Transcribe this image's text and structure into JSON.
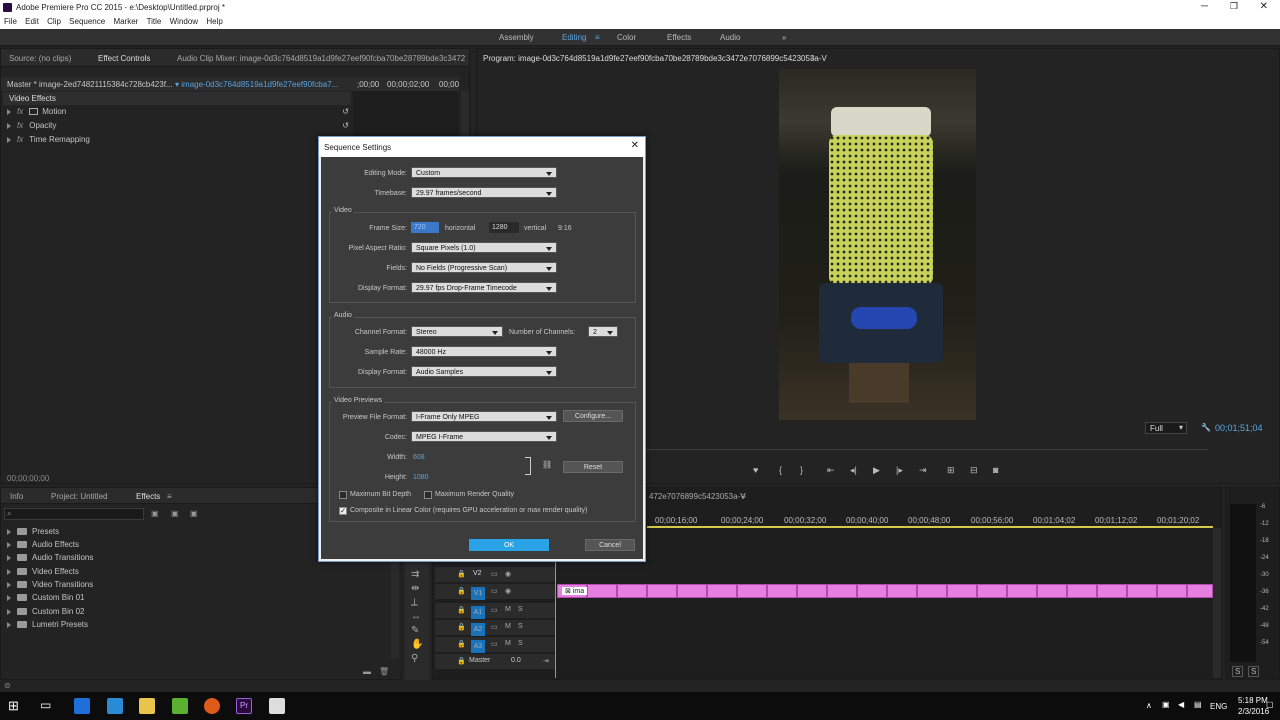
{
  "app": {
    "title": "Adobe Premiere Pro CC 2015 - e:\\Desktop\\Untitled.prproj *"
  },
  "menu": [
    "File",
    "Edit",
    "Clip",
    "Sequence",
    "Marker",
    "Title",
    "Window",
    "Help"
  ],
  "workspaces": [
    "Assembly",
    "Editing",
    "Color",
    "Effects",
    "Audio"
  ],
  "tabs_top": {
    "source": "Source: (no clips)",
    "effect_controls": "Effect Controls",
    "audio_mixer": "Audio Clip Mixer: image-0d3c764d8519a1d9fe27eef90fcba70be28789bde3c3472"
  },
  "effect_controls": {
    "master": "Master * image-2ed74821115384c728cb423f...",
    "clip": "image-0d3c764d8519a1d9fe27eef90fcba7...",
    "section": "Video Effects",
    "effects": [
      "Motion",
      "Opacity",
      "Time Remapping"
    ],
    "tc_start": ";00;00",
    "tc_mid": "00;00;02;00",
    "tc_end": "00;00",
    "clip_label": "image-2ed74821115384c728cb4",
    "timecode": "00;00;00;00"
  },
  "program": {
    "tab": "Program: image-0d3c764d8519a1d9fe27eef90fcba70be28789bde3c3472e7076899c5423053a-V",
    "zoom": "Full",
    "timecode": "00;01;51;04"
  },
  "bottom_tabs": {
    "info": "Info",
    "project": "Project: Untitled",
    "effects": "Effects"
  },
  "effects_panel": {
    "folders": [
      "Presets",
      "Audio Effects",
      "Audio Transitions",
      "Video Effects",
      "Video Transitions",
      "Custom Bin 01",
      "Custom Bin 02",
      "Lumetri Presets"
    ]
  },
  "timeline": {
    "tab": "472e7076899c5423053a-V",
    "ruler": [
      "00;00;16;00",
      "00;00;24;00",
      "00;00;32;00",
      "00;00;40;00",
      "00;00;48;00",
      "00;00;56;00",
      "00;01;04;02",
      "00;01;12;02",
      "00;01;20;02"
    ],
    "tracks": [
      "V2",
      "V1",
      "A1",
      "A2",
      "A3"
    ],
    "master": "Master",
    "master_val": "0.0",
    "clip_text": "ima"
  },
  "meter": {
    "labels": [
      "-6",
      "-12",
      "-18",
      "-24",
      "-30",
      "-36",
      "-42",
      "-48",
      "-54"
    ],
    "s": "S"
  },
  "dialog": {
    "title": "Sequence Settings",
    "editing_mode_label": "Editing Mode:",
    "editing_mode": "Custom",
    "timebase_label": "Timebase:",
    "timebase": "29.97  frames/second",
    "video_group": "Video",
    "frame_size_label": "Frame Size:",
    "frame_w": "720",
    "horizontal": "horizontal",
    "frame_h": "1280",
    "vertical": "vertical",
    "ratio": "9:16",
    "par_label": "Pixel Aspect Ratio:",
    "par": "Square Pixels (1.0)",
    "fields_label": "Fields:",
    "fields": "No Fields (Progressive Scan)",
    "vdisplay_label": "Display Format:",
    "vdisplay": "29.97 fps Drop-Frame Timecode",
    "audio_group": "Audio",
    "channel_label": "Channel Format:",
    "channel": "Stereo",
    "numch_label": "Number of Channels:",
    "numch": "2",
    "sr_label": "Sample Rate:",
    "sr": "48000 Hz",
    "adisplay_label": "Display Format:",
    "adisplay": "Audio Samples",
    "preview_group": "Video Previews",
    "pff_label": "Preview File Format:",
    "pff": "I-Frame Only MPEG",
    "configure": "Configure...",
    "codec_label": "Codec:",
    "codec": "MPEG I-Frame",
    "width_label": "Width:",
    "width": "608",
    "height_label": "Height:",
    "height": "1080",
    "reset": "Reset",
    "max_bit": "Maximum Bit Depth",
    "max_render": "Maximum Render Quality",
    "composite": "Composite in Linear Color (requires GPU acceleration or max render quality)",
    "ok": "OK",
    "cancel": "Cancel"
  },
  "taskbar": {
    "lang": "ENG",
    "time": "5:18 PM",
    "date": "2/3/2016"
  }
}
